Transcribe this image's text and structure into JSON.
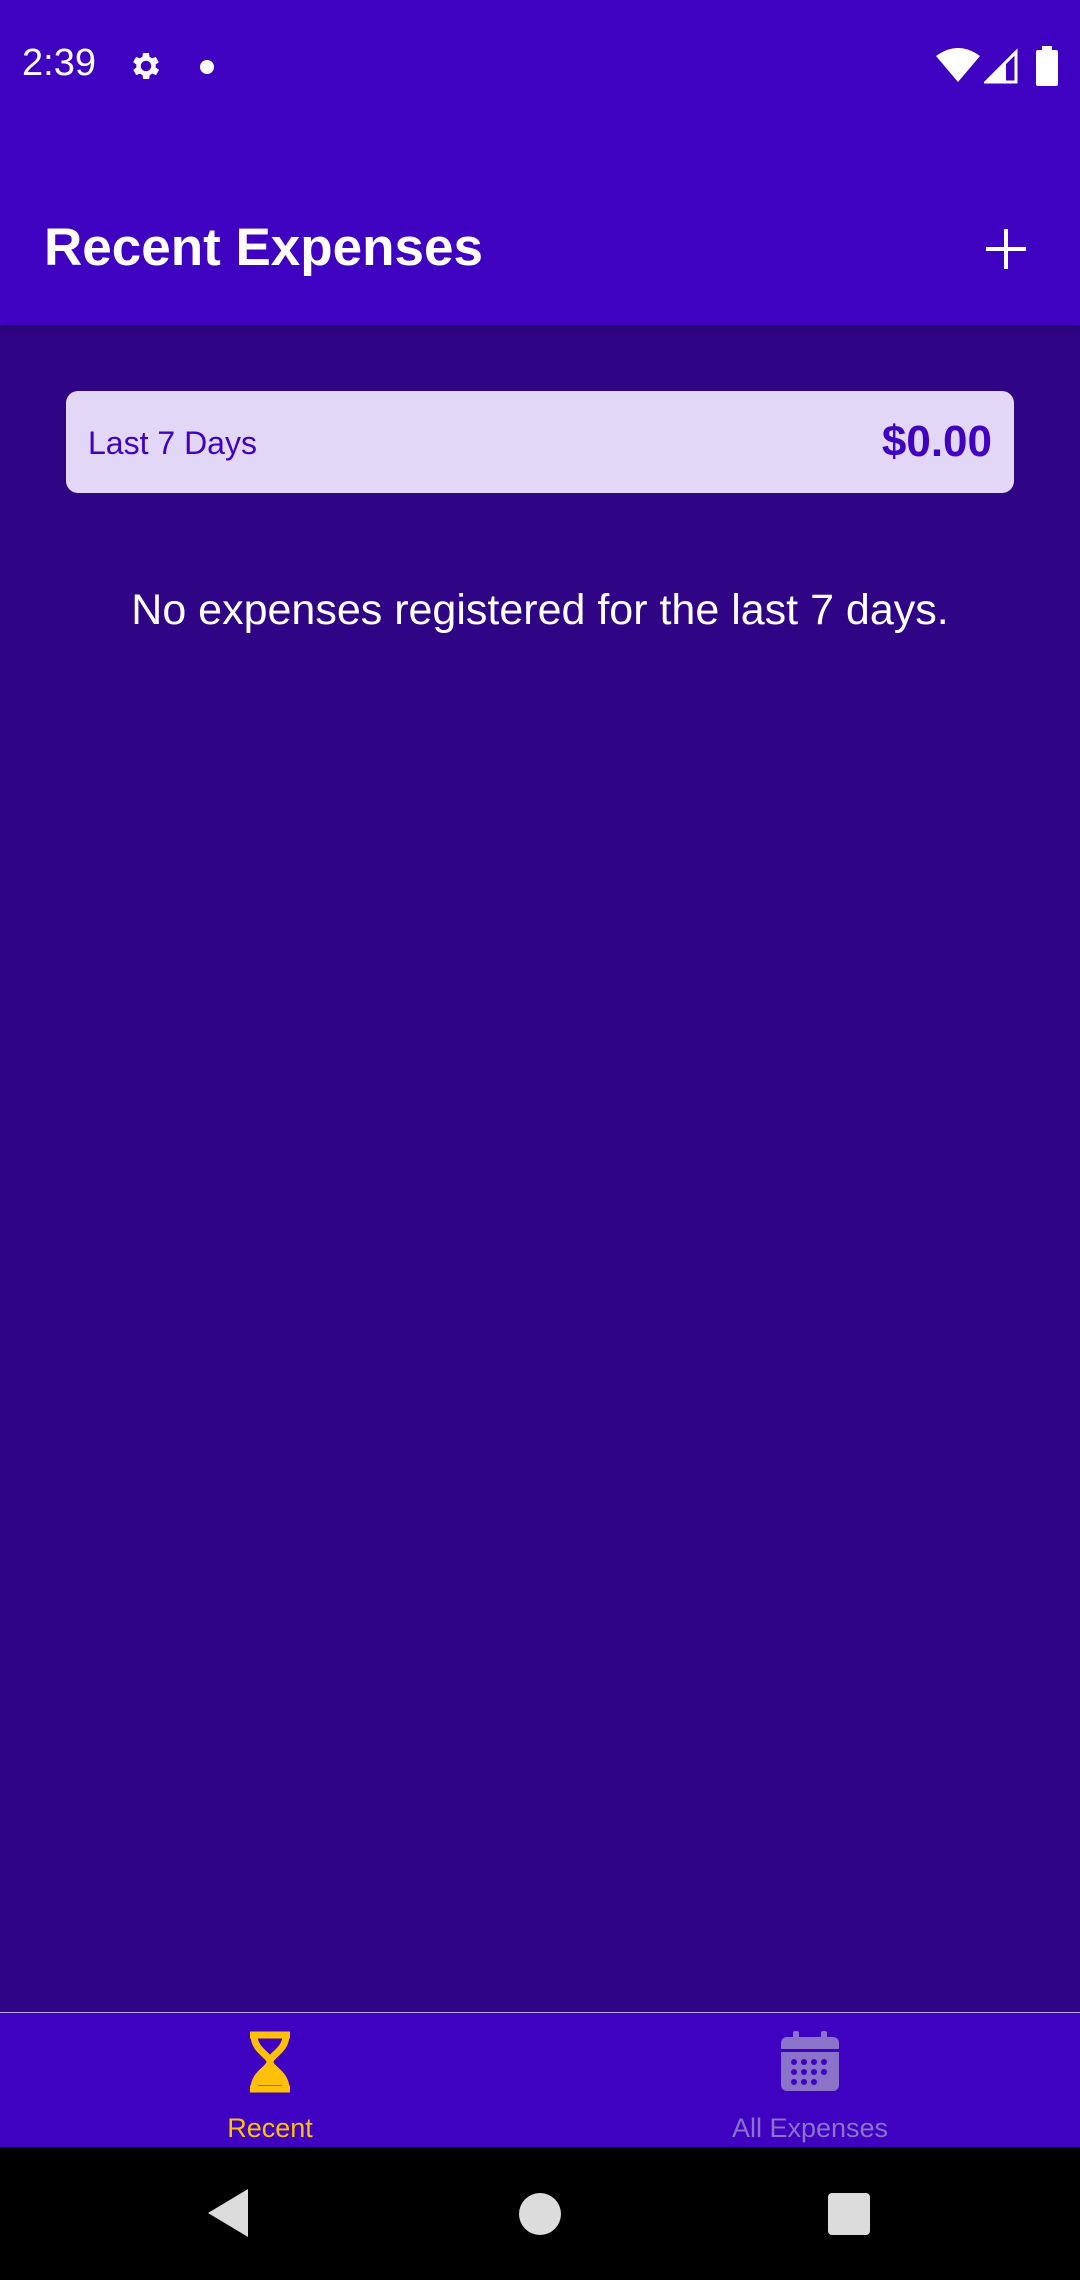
{
  "status_bar": {
    "time": "2:39",
    "icons": [
      "gear-icon",
      "notification-dot-icon",
      "wifi-icon",
      "cellular-signal-icon",
      "battery-icon"
    ]
  },
  "app_bar": {
    "title": "Recent Expenses",
    "add_icon": "plus-icon"
  },
  "summary": {
    "period": "Last 7 Days",
    "sum": "$0.00"
  },
  "empty_message": "No expenses registered for the last 7 days.",
  "bottom_nav": {
    "items": [
      {
        "label": "Recent",
        "icon": "hourglass-icon",
        "active": true
      },
      {
        "label": "All Expenses",
        "icon": "calendar-icon",
        "active": false
      }
    ]
  },
  "system_nav": {
    "icons": [
      "back-triangle-icon",
      "home-circle-icon",
      "recents-square-icon"
    ]
  },
  "colors": {
    "primary": "#3f02c1",
    "background": "#2f0585",
    "card": "#e2d7f7",
    "accent": "#ffc107",
    "inactive": "#8a73c9"
  }
}
